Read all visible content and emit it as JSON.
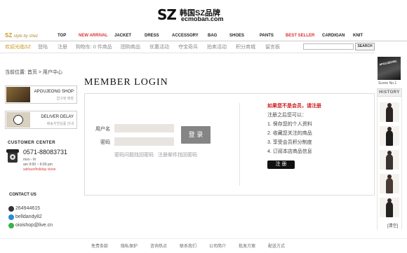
{
  "logo": {
    "mark": "SZ",
    "title": "韩国SZ品牌",
    "sub": "ecmoban.com"
  },
  "nav": {
    "brand": "SZ",
    "brand_tag": "style by shez",
    "items": [
      "TOP",
      "NEW ARRIVAL",
      "JACKET",
      "DRESS",
      "ACCESSORY",
      "BAG",
      "SHOES",
      "PANTS",
      "BEST SELLER",
      "CARDIGAN",
      "KNIT"
    ]
  },
  "subnav": {
    "items": [
      "欢迎光临SZ",
      "登陆",
      "注册",
      "购物车: 0 件商品",
      "团购商品",
      "优惠活动",
      "夺宝奇兵",
      "拍卖活动",
      "积分商城",
      "留言板"
    ],
    "search_button": "SEARCH"
  },
  "breadcrumb": "当前位置: 首页 > 用户中心",
  "sidebar": {
    "promos": [
      {
        "title": "APGUJEONG SHOP",
        "sub": "압구정 매장"
      },
      {
        "title": "DELIVER DELAY",
        "sub": "배송지연상품 안내"
      }
    ],
    "customer_center": "CUSTOMER CENTER",
    "phone": "0571-88083731",
    "hours": [
      "mon - fri",
      "am 9:00 ~ 6:00 pm",
      "sat/sun/holiday close"
    ],
    "contact_label": "CONTACT US",
    "contacts": [
      "264944615",
      "belldandy82",
      "oioishop@live.cn"
    ]
  },
  "login": {
    "title": "MEMBER LOGIN",
    "username_label": "用户名",
    "password_label": "密码",
    "login_button": "登 录",
    "links": [
      "密码问题找回密码",
      "注册邮件找回密码"
    ]
  },
  "register": {
    "title": "如果您不是会员，请注册",
    "subtitle": "注册之后您可以：",
    "benefits": [
      "1. 保存您的个人资料",
      "2. 收藏您关注的商品",
      "3. 享受会员积分制度",
      "4. 订阅本店商品信息"
    ],
    "button": "注 册"
  },
  "right": {
    "scene_label": "Scene No.1",
    "scene_img_text": "APGUJEONG",
    "history": "HISTORY",
    "more": "[清空]"
  },
  "footer": {
    "items": [
      "免责条款",
      "隐私保护",
      "咨询热点",
      "联系我们",
      "公司简介",
      "批发方案",
      "配送方式"
    ]
  },
  "colors": {
    "accent": "#c89820",
    "red": "#d33333",
    "button": "#858585"
  }
}
